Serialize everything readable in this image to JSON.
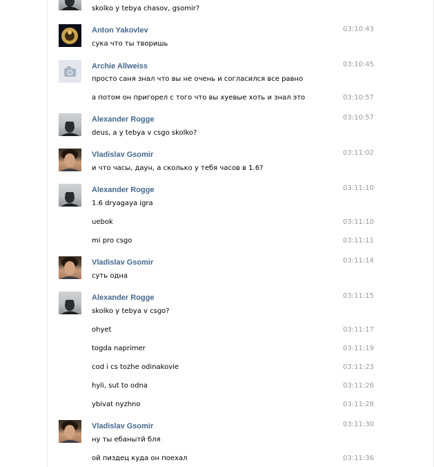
{
  "colors": {
    "name": "#45688e",
    "time": "#999999",
    "text": "#000000"
  },
  "top_message": {
    "text": "skolko y tebya chasov, gsomir?"
  },
  "messages": [
    {
      "name": "Anton Yakovlev",
      "time": "03:10:43",
      "text": "сука что ты творишь",
      "avatar": "anton-avatar"
    },
    {
      "name": "Archie Allweiss",
      "time": "03:10:45",
      "text": "просто саня знал что вы не очень и согласился все равно",
      "avatar": "camera-placeholder-icon"
    },
    {
      "time": "03:10:57",
      "text": "а потом он пригорел с того что вы хуевые хоть и знал это"
    },
    {
      "name": "Alexander Rogge",
      "time": "03:10:57",
      "text": "deus, a y tebya v csgo skolko?",
      "avatar": "alexander-avatar"
    },
    {
      "name": "Vladislav Gsomir",
      "time": "03:11:02",
      "text": "и что часы, даун, а сколько у тебя часов в 1.6?",
      "avatar": "vladislav-avatar"
    },
    {
      "name": "Alexander Rogge",
      "time": "03:11:10",
      "text": "1.6 dryagaya igra",
      "avatar": "alexander-avatar"
    },
    {
      "time": "03:11:10",
      "text": "uebok"
    },
    {
      "time": "03:11:11",
      "text": "mi pro csgo"
    },
    {
      "name": "Vladislav Gsomir",
      "time": "03:11:14",
      "text": "суть одна",
      "avatar": "vladislav-avatar"
    },
    {
      "name": "Alexander Rogge",
      "time": "03:11:15",
      "text": "skolko y tebya v csgo?",
      "avatar": "alexander-avatar"
    },
    {
      "time": "03:11:17",
      "text": "ohyet"
    },
    {
      "time": "03:11:19",
      "text": "togda naprimer"
    },
    {
      "time": "03:11:23",
      "text": "cod i cs tozhe odinakovie"
    },
    {
      "time": "03:11:26",
      "text": "hyli, sut to odna"
    },
    {
      "time": "03:11:28",
      "text": "ybivat nyzhno"
    },
    {
      "name": "Vladislav Gsomir",
      "time": "03:11:30",
      "text": "ну ты ебанытй бля",
      "avatar": "vladislav-avatar"
    },
    {
      "time": "03:11:36",
      "text": "ой пиздец куда он поехал"
    }
  ]
}
